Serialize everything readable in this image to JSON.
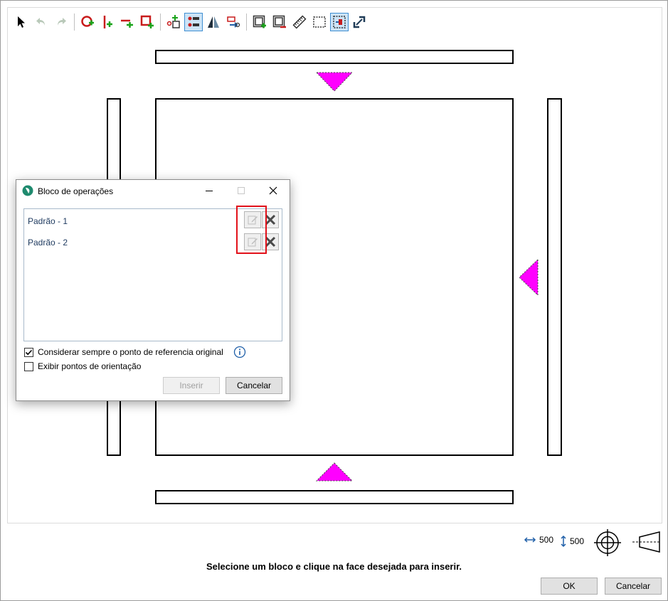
{
  "toolbar": {
    "icons": [
      "select-arrow-icon",
      "undo-icon",
      "redo-icon",
      "rotate-add-icon",
      "insert-vertical-icon",
      "insert-horizontal-icon",
      "add-rectangle-icon",
      "node-add-icon",
      "list-grid-icon",
      "mirror-icon",
      "move-group-icon",
      "add-frame-icon",
      "remove-frame-icon",
      "ruler-icon",
      "dotted-rect-icon",
      "panel-active-icon",
      "resize-icon"
    ]
  },
  "dialog": {
    "title": "Bloco de operações",
    "items": [
      {
        "label": "Padrão - 1"
      },
      {
        "label": "Padrão - 2"
      }
    ],
    "checkbox_reference": {
      "label": "Considerar sempre o ponto de referencia original",
      "checked": true
    },
    "checkbox_orientation": {
      "label": "Exibir pontos de orientação",
      "checked": false
    },
    "insert_label": "Inserir",
    "cancel_label": "Cancelar"
  },
  "status": {
    "message": "Selecione um bloco e clique na face desejada para inserir."
  },
  "dimensions": {
    "width": "500",
    "height": "500"
  },
  "footer": {
    "ok_label": "OK",
    "cancel_label": "Cancelar"
  },
  "colors": {
    "marker": "#ff00ff",
    "highlight": "#e2111a"
  }
}
